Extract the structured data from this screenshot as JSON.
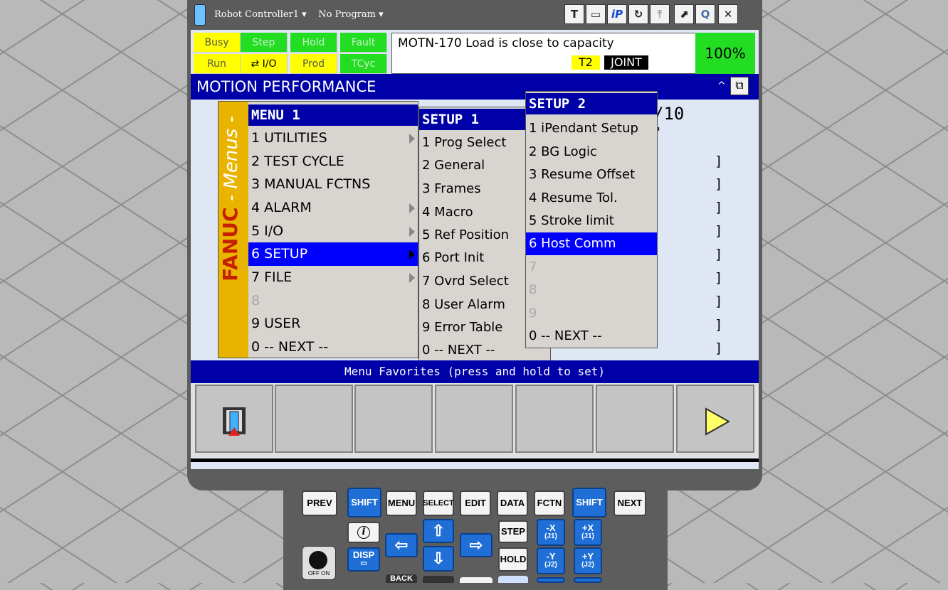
{
  "titlebar": {
    "controller": "Robot Controller1",
    "program": "No Program",
    "buttons": [
      "T",
      "▭",
      "iP",
      "↻",
      "⤒",
      "⬈",
      "Q",
      "✕"
    ]
  },
  "status": {
    "busy": "Busy",
    "step": "Step",
    "hold": "Hold",
    "fault": "Fault",
    "run": "Run",
    "io": "I/O",
    "prod": "Prod",
    "tcyc": "TCyc",
    "io_icon": "⇄"
  },
  "alarm": {
    "message": "MOTN-170 Load is close to capacity",
    "mode": "T2",
    "coord": "JOINT",
    "override": "100%"
  },
  "page": {
    "title": "MOTION PERFORMANCE",
    "fragment_count": "/10",
    "fragment_comma": "'",
    "bracket": "]"
  },
  "menus": {
    "side_label": "- Menus -",
    "brand": "FANUC",
    "menu1": {
      "title": "MENU  1",
      "items": [
        "1 UTILITIES",
        "2 TEST CYCLE",
        "3 MANUAL FCTNS",
        "4 ALARM",
        "5 I/O",
        "6 SETUP",
        "7 FILE",
        "8",
        "9 USER",
        "0 -- NEXT --"
      ]
    },
    "setup1": {
      "title": "SETUP  1",
      "items": [
        "1 Prog Select",
        "2 General",
        "3 Frames",
        "4 Macro",
        "5 Ref Position",
        "6 Port Init",
        "7 Ovrd Select",
        "8 User Alarm",
        "9 Error Table",
        "0 -- NEXT --"
      ]
    },
    "setup2": {
      "title": "SETUP  2",
      "items": [
        "1 iPendant Setup",
        "2 BG Logic",
        "3 Resume Offset",
        "4 Resume Tol.",
        "5 Stroke limit",
        "6 Host Comm",
        "7",
        "8",
        "9",
        "0 -- NEXT --"
      ]
    }
  },
  "favorites": {
    "label": "Menu Favorites (press and hold to set)"
  },
  "keypad": {
    "prev": "PREV",
    "shift": "SHIFT",
    "menu": "MENU",
    "select": "SELECT",
    "edit": "EDIT",
    "data": "DATA",
    "fctn": "FCTN",
    "next": "NEXT",
    "step": "STEP",
    "hold": "HOLD",
    "disp": "DISP",
    "info": "i",
    "minus_x": "-X",
    "plus_x": "+X",
    "j1": "(J1)",
    "minus_y": "-Y",
    "plus_y": "+Y",
    "j2": "(J2)",
    "off_on": "OFF  ON",
    "back": "BACK"
  },
  "colors": {
    "menu_header": "#0000a8",
    "selection": "#0000ff",
    "status_green": "#22dd22",
    "status_yellow": "#ffff00",
    "brand_strip": "#e8b400"
  }
}
